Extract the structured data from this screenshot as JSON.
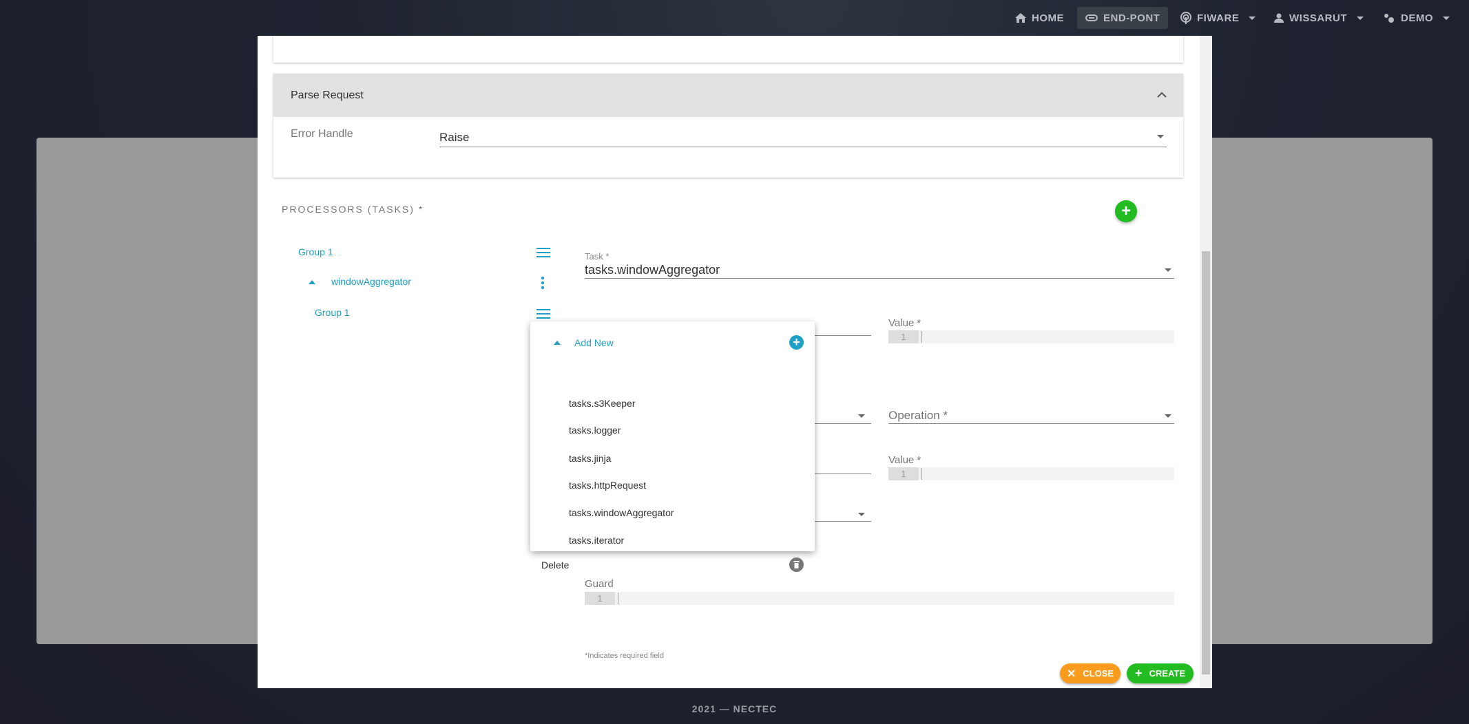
{
  "navbar": {
    "items": [
      {
        "label": "HOME",
        "icon": "home-icon"
      },
      {
        "label": "END-PONT",
        "icon": "link-icon",
        "active": true
      },
      {
        "label": "FIWARE",
        "icon": "fiware-icon",
        "dropdown": true
      },
      {
        "label": "WISSARUT",
        "icon": "user-icon",
        "dropdown": true
      },
      {
        "label": "DEMO",
        "icon": "gears-icon",
        "dropdown": true
      }
    ]
  },
  "parse_request": {
    "title": "Parse Request",
    "error_handle_label": "Error Handle",
    "error_handle_value": "Raise"
  },
  "processors": {
    "title": "PROCESSORS (TASKS) *",
    "tree": [
      {
        "label": "Group 1"
      },
      {
        "label": "windowAggregator"
      },
      {
        "label": "Group 1"
      }
    ]
  },
  "task_form": {
    "task_label": "Task *",
    "task_value": "tasks.windowAggregator",
    "value_label_1": "Value *",
    "value_label_2": "Value *",
    "operation_label": "Operation *",
    "code_line": "1",
    "guard_label": "Guard",
    "required_note": "*Indicates required field"
  },
  "menu": {
    "add_new": "Add New",
    "items": [
      "tasks.s3Keeper",
      "tasks.logger",
      "tasks.jinja",
      "tasks.httpRequest",
      "tasks.windowAggregator",
      "tasks.iterator"
    ],
    "delete": "Delete"
  },
  "buttons": {
    "close": "CLOSE",
    "create": "CREATE"
  },
  "colors": {
    "accent": "#1fa0c4",
    "close": "#f99b1c",
    "create": "#22bb22"
  },
  "footer": "2021 — NECTEC"
}
